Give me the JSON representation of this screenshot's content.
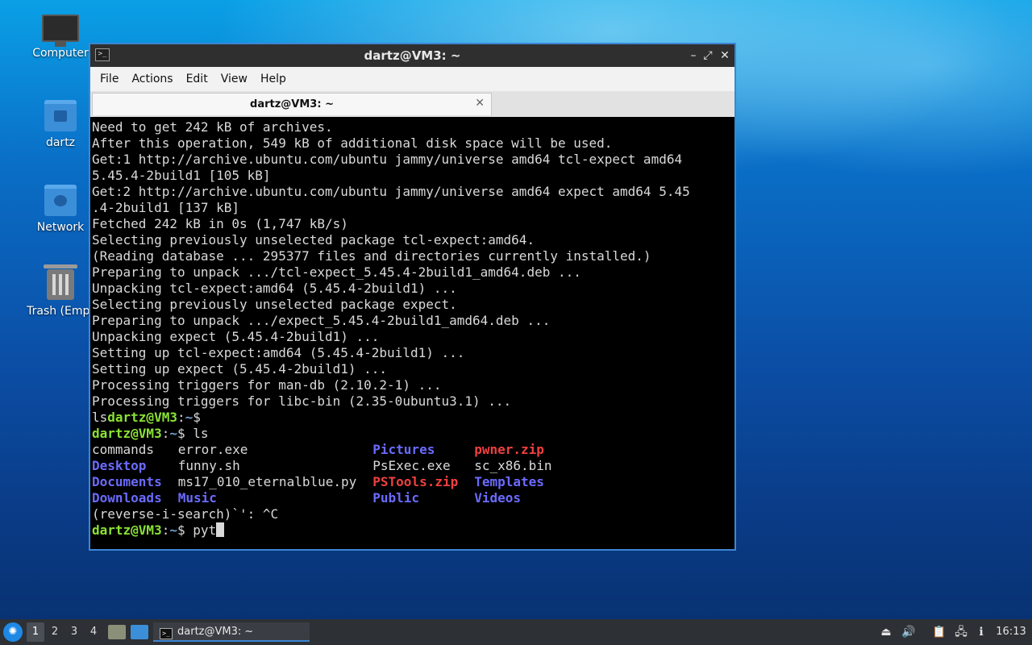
{
  "desktop": {
    "icons": [
      {
        "label": "Computer"
      },
      {
        "label": "dartz"
      },
      {
        "label": "Network"
      },
      {
        "label": "Trash (Empt"
      }
    ]
  },
  "window": {
    "title": "dartz@VM3: ~",
    "title_icon": ">_",
    "controls": {
      "minimize": "–",
      "maximize": "⤢",
      "close": "✕"
    },
    "menu": [
      "File",
      "Actions",
      "Edit",
      "View",
      "Help"
    ],
    "tab": {
      "label": "dartz@VM3: ~",
      "close": "✕"
    }
  },
  "terminal": {
    "output_lines": [
      "Need to get 242 kB of archives.",
      "After this operation, 549 kB of additional disk space will be used.",
      "Get:1 http://archive.ubuntu.com/ubuntu jammy/universe amd64 tcl-expect amd64",
      "5.45.4-2build1 [105 kB]",
      "Get:2 http://archive.ubuntu.com/ubuntu jammy/universe amd64 expect amd64 5.45",
      ".4-2build1 [137 kB]",
      "Fetched 242 kB in 0s (1,747 kB/s)",
      "Selecting previously unselected package tcl-expect:amd64.",
      "(Reading database ... 295377 files and directories currently installed.)",
      "Preparing to unpack .../tcl-expect_5.45.4-2build1_amd64.deb ...",
      "Unpacking tcl-expect:amd64 (5.45.4-2build1) ...",
      "Selecting previously unselected package expect.",
      "Preparing to unpack .../expect_5.45.4-2build1_amd64.deb ...",
      "Unpacking expect (5.45.4-2build1) ...",
      "Setting up tcl-expect:amd64 (5.45.4-2build1) ...",
      "Setting up expect (5.45.4-2build1) ...",
      "Processing triggers for man-db (2.10.2-1) ...",
      "Processing triggers for libc-bin (2.35-0ubuntu3.1) ..."
    ],
    "prompt_user": "dartz@VM3",
    "prompt_sep": ":",
    "prompt_path": "~",
    "prompt_end": "$ ",
    "line_ls_prefix": "ls",
    "line_ls_prompt_end": "$",
    "ls_command": "ls",
    "ls_rows": [
      [
        {
          "t": "commands",
          "k": "file"
        },
        {
          "t": "error.exe",
          "k": "file"
        },
        {
          "t": "Pictures",
          "k": "dir"
        },
        {
          "t": "pwner.zip",
          "k": "zip"
        }
      ],
      [
        {
          "t": "Desktop",
          "k": "dir"
        },
        {
          "t": "funny.sh",
          "k": "file"
        },
        {
          "t": "PsExec.exe",
          "k": "file"
        },
        {
          "t": "sc_x86.bin",
          "k": "file"
        }
      ],
      [
        {
          "t": "Documents",
          "k": "dir"
        },
        {
          "t": "ms17_010_eternalblue.py",
          "k": "file"
        },
        {
          "t": "PSTools.zip",
          "k": "zip"
        },
        {
          "t": "Templates",
          "k": "dir"
        }
      ],
      [
        {
          "t": "Downloads",
          "k": "dir"
        },
        {
          "t": "Music",
          "k": "dir"
        },
        {
          "t": "Public",
          "k": "dir"
        },
        {
          "t": "Videos",
          "k": "dir"
        }
      ]
    ],
    "reverse_search_line": "(reverse-i-search)`': ^C",
    "current_input": "pyt"
  },
  "taskbar": {
    "start_icon": "start-menu-icon",
    "workspaces": [
      "1",
      "2",
      "3",
      "4"
    ],
    "active_workspace": "1",
    "task_label": "dartz@VM3: ~",
    "task_icon": ">_",
    "clock": "16:13"
  }
}
